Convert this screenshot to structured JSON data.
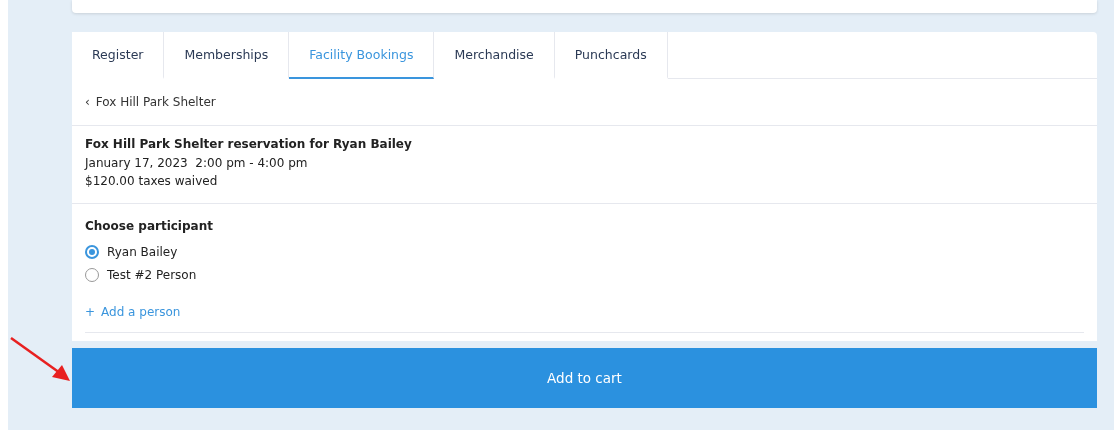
{
  "tabs": [
    {
      "label": "Register",
      "selected": false
    },
    {
      "label": "Memberships",
      "selected": false
    },
    {
      "label": "Facility Bookings",
      "selected": true
    },
    {
      "label": "Merchandise",
      "selected": false
    },
    {
      "label": "Punchcards",
      "selected": false
    }
  ],
  "back_link": {
    "icon": "‹",
    "label": "Fox Hill Park Shelter"
  },
  "reservation": {
    "title": "Fox Hill Park Shelter reservation for Ryan Bailey",
    "datetime": "January 17, 2023  2:00 pm - 4:00 pm",
    "price": "$120.00 taxes waived"
  },
  "participants": {
    "heading": "Choose participant",
    "options": [
      {
        "label": "Ryan Bailey",
        "selected": true
      },
      {
        "label": "Test #2 Person",
        "selected": false
      }
    ],
    "add_link": {
      "icon": "+",
      "label": "Add a person"
    }
  },
  "add_to_cart_button": "Add to cart"
}
